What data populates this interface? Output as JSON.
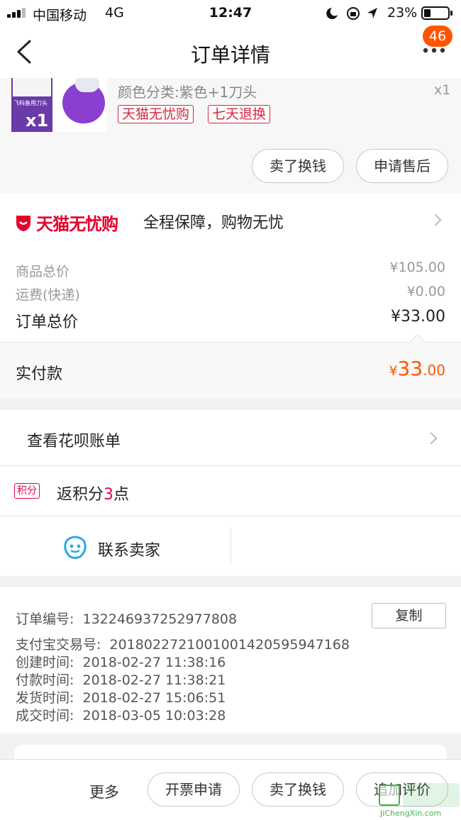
{
  "status_bar": {
    "carrier": "中国移动",
    "network": "4G",
    "time": "12:47",
    "battery": "23%"
  },
  "nav": {
    "title": "订单详情",
    "badge": "46"
  },
  "product": {
    "thumb_caption": "飞科备用刀头",
    "thumb_count": "x1",
    "sku": "颜色分类:紫色+1刀头",
    "qty": "x1",
    "tags": [
      "天猫无忧购",
      "七天退换"
    ],
    "buttons": [
      "卖了换钱",
      "申请售后"
    ]
  },
  "guarantee": {
    "logo_text": "天猫无忧购",
    "text": "全程保障，购物无忧"
  },
  "prices": {
    "goods_label": "商品总价",
    "goods_value": "¥105.00",
    "shipping_label": "运费(快递)",
    "shipping_value": "¥0.00",
    "total_label": "订单总价",
    "total_value": "¥33.00",
    "paid_label": "实付款",
    "paid_currency": "¥",
    "paid_int": "33",
    "paid_dec": ".00"
  },
  "huabei": {
    "label": "查看花呗账单"
  },
  "points": {
    "tag": "积分",
    "prefix": "返积分",
    "count": "3",
    "suffix": "点"
  },
  "contact": {
    "label": "联系卖家"
  },
  "order_info": {
    "order_no_label": "订单编号:",
    "order_no": "132246937252977808",
    "copy_label": "复制",
    "alipay_label": "支付宝交易号:",
    "alipay_no": "2018022721001001420595947168",
    "created_label": "创建时间:",
    "created": "2018-02-27 11:38:16",
    "paid_label": "付款时间:",
    "paid": "2018-02-27 11:38:21",
    "shipped_label": "发货时间:",
    "shipped": "2018-02-27 15:06:51",
    "closed_label": "成交时间:",
    "closed": "2018-03-05 10:03:28"
  },
  "bottom_bar": {
    "more": "更多",
    "buttons": [
      "开票申请",
      "卖了换钱",
      "追加评价"
    ]
  },
  "watermark": {
    "site": "JiChengXin.com"
  },
  "colors": {
    "accent": "#ff5500",
    "tmall_red": "#e4002b",
    "points_pink": "#e8005a",
    "wangwang_blue": "#2aa8e8"
  }
}
